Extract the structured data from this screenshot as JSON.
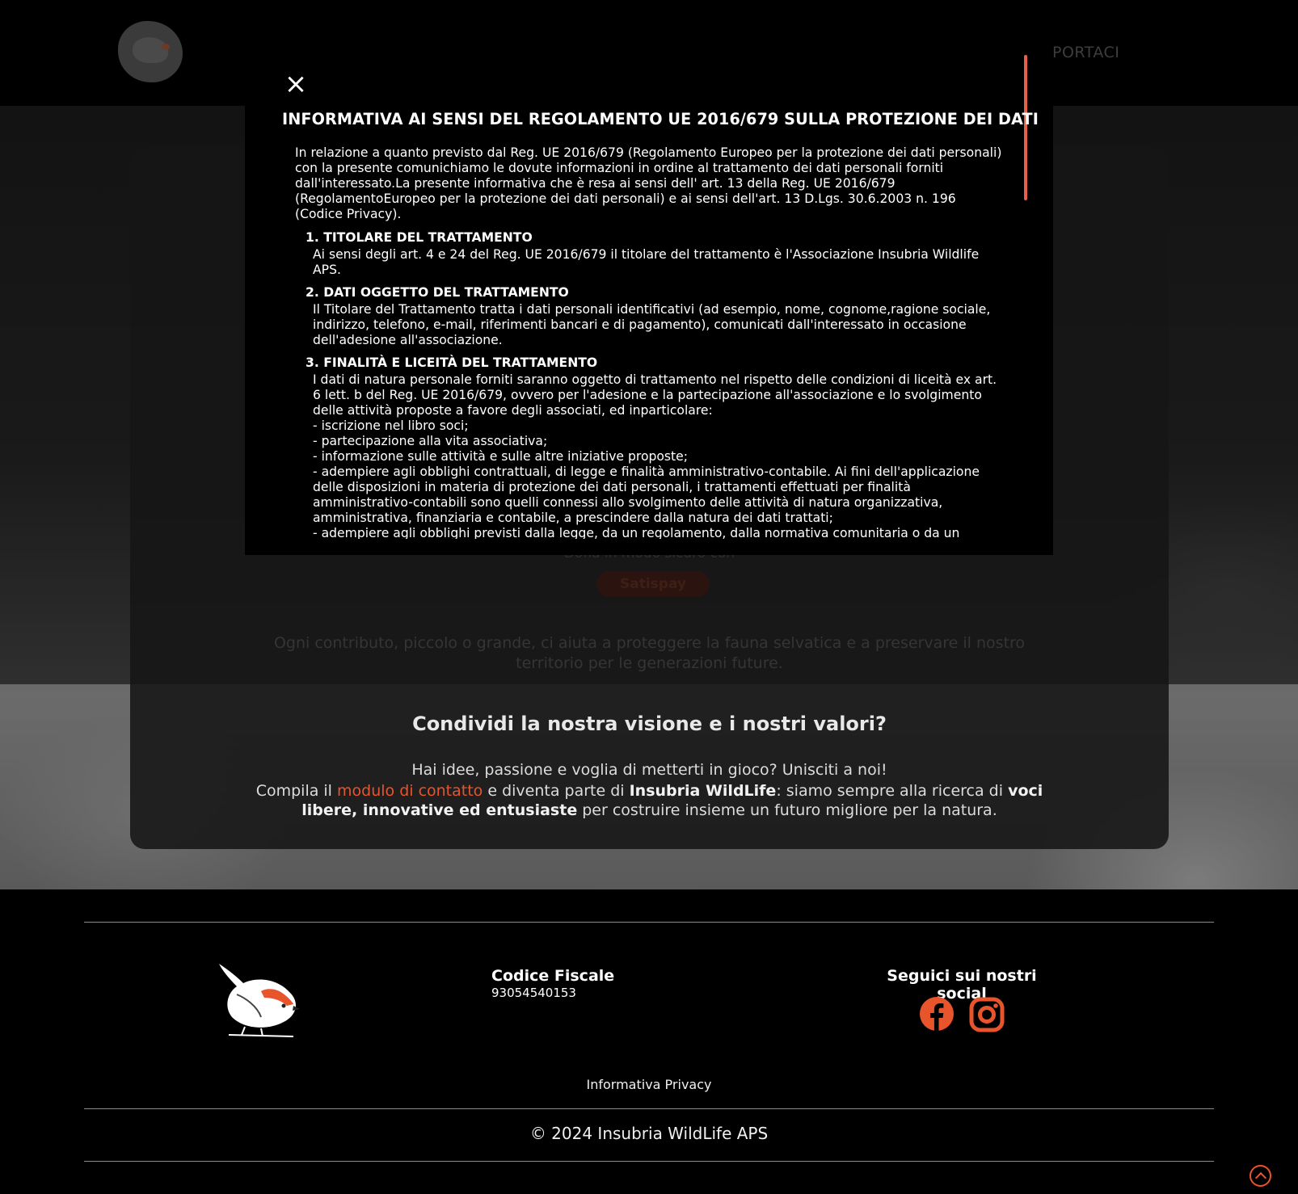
{
  "header": {
    "nav_item": "PORTACI"
  },
  "modal": {
    "close_symbol": "×",
    "title": "INFORMATIVA AI SENSI DEL REGOLAMENTO UE 2016/679 SULLA PROTEZIONE DEI DATI",
    "intro": "In relazione a quanto previsto dal Reg. UE 2016/679 (Regolamento Europeo per la protezione dei dati personali) con la presente comunichiamo le dovute informazioni in ordine al trattamento dei dati personali forniti dall'interessato.La presente informativa che è resa ai sensi dell' art. 13 della Reg. UE 2016/679 (RegolamentoEuropeo per la protezione dei dati personali) e ai sensi dell'art. 13 D.Lgs. 30.6.2003 n. 196 (Codice Privacy).",
    "sections": [
      {
        "title": "1. TITOLARE DEL TRATTAMENTO",
        "text": "Ai sensi degli art. 4 e 24 del Reg. UE 2016/679 il titolare del trattamento è l'Associazione Insubria Wildlife APS."
      },
      {
        "title": "2. DATI OGGETTO DEL TRATTAMENTO",
        "text": "Il Titolare del Trattamento tratta i dati personali identificativi (ad esempio, nome, cognome,ragione sociale, indirizzo, telefono, e-mail, riferimenti bancari e di pagamento), comunicati dall'interessato in occasione dell'adesione all'associazione."
      },
      {
        "title": "3. FINALITÀ E LICEITÀ DEL TRATTAMENTO",
        "text": "I dati di natura personale forniti saranno oggetto di trattamento nel rispetto delle condizioni di liceità ex art. 6 lett. b del Reg. UE 2016/679, ovvero per l'adesione e la partecipazione all'associazione e lo svolgimento delle attività proposte a favore degli associati, ed inparticolare:\n- iscrizione nel libro soci;\n- partecipazione alla vita associativa;\n- informazione sulle attività e sulle altre iniziative proposte;\n- adempiere agli obblighi contrattuali, di legge e finalità amministrativo-contabile. Ai fini dell'applicazione delle disposizioni in materia di protezione dei dati personali, i trattamenti effettuati per finalità amministrativo-contabili sono quelli connessi allo svolgimento delle attività di natura organizzativa, amministrativa, finanziaria e contabile, a prescindere dalla natura dei dati trattati;\n- adempiere agli obblighi previsti dalla legge, da un regolamento, dalla normativa comunitaria o da un"
      }
    ]
  },
  "content": {
    "donate_text": "Dona in modo sicuro con",
    "satispay_label": "Satispay",
    "contribution_text": "Ogni contributo, piccolo o grande, ci aiuta a proteggere la fauna selvatica e a preservare il nostro territorio per le generazioni future.",
    "share_title": "Condividi la nostra visione e i nostri valori?",
    "share_line1": "Hai idee, passione e voglia di metterti in gioco? Unisciti a noi!",
    "share_line2_a": "Compila il ",
    "share_line2_link": "modulo di contatto",
    "share_line2_b": " e diventa parte di ",
    "share_line2_bold1": "Insubria WildLife",
    "share_line2_c": ": siamo sempre alla ricerca di ",
    "share_line2_bold2": "voci libere, innovative ed entusiaste",
    "share_line2_d": " per costruire insieme un futuro migliore per la natura."
  },
  "footer": {
    "cf_title": "Codice Fiscale",
    "cf_value": "93054540153",
    "social_title": "Seguici sui nostri social",
    "privacy_link": "Informativa Privacy",
    "copyright": "© 2024 Insubria WildLife APS"
  },
  "colors": {
    "accent": "#e8542b",
    "scroll_thumb": "#e5604a",
    "background": "#000000"
  },
  "icons": {
    "close": "close-icon",
    "facebook": "facebook-icon",
    "instagram": "instagram-icon",
    "scroll_top": "chevron-up-circle-icon",
    "logo": "bird-logo-icon"
  }
}
